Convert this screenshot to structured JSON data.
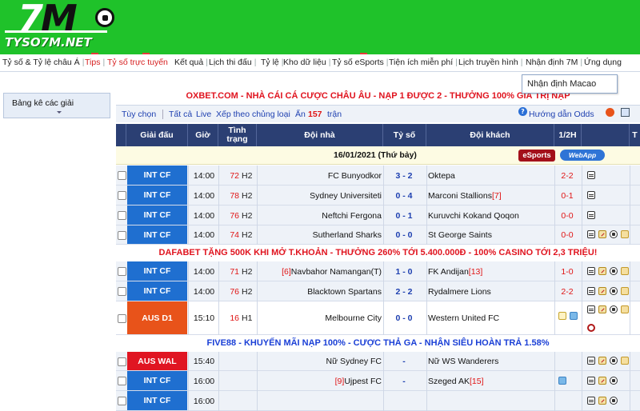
{
  "logo": {
    "seven": "7",
    "m": "M",
    "site": "TYSO7M.NET"
  },
  "nav": {
    "items": [
      "Tỷ số & Tỷ lệ châu Á",
      "Tips",
      "Tỷ số trực tuyến",
      "Kết quả",
      "Lịch thi đấu",
      "Tỷ lệ",
      "Kho dữ liệu",
      "Tỷ số eSports",
      "Tiện ích miễn phí",
      "Lịch truyền hình",
      "Nhận định 7M",
      "Ứng dụng"
    ],
    "dropdown": "Nhận định Macao"
  },
  "sidebar": {
    "label": "Bảng kê các giải"
  },
  "promos": {
    "top": "OXBET.COM - NHÀ CÁI CÁ CƯỢC CHÂU ÂU - NẠP 1 ĐƯỢC 2 - THƯỞNG 100% GIÁ TRỊ NẠP",
    "middle": "DAFABET TẶNG 500K KHI MỞ T.KHOẢN - THƯỞNG 260% TỚI 5.400.000Đ - 100% CASINO TỚI 2,3 TRIỆU!",
    "bottom": "FIVE88 - KHUYẾN MÃI NẠP 100% - CƯỢC THẢ GA - NHẬN SIÊU HOÀN TRẢ 1.58%"
  },
  "filter": {
    "custom": "Tùy chọn",
    "all": "Tất cả",
    "live": "Live",
    "sort": "Xếp theo chủng loại",
    "hide": "Ẩn",
    "hidden_count": "157",
    "matches": "trận",
    "guide": "Hướng dẫn Odds"
  },
  "columns": {
    "league": "Giải đấu",
    "time": "Giờ",
    "status": "Tình trạng",
    "home": "Đội nhà",
    "score": "Tỷ số",
    "away": "Đội khách",
    "half": "1/2H",
    "more": "T"
  },
  "date_row": {
    "date": "16/01/2021 (Thứ bảy)",
    "esports": "eSports",
    "webapp": "WebApp"
  },
  "matches": [
    {
      "league": "INT CF",
      "league_color": "#1f6fd0",
      "time": "14:00",
      "min": "72",
      "half": "H2",
      "home_rank": "",
      "home": "FC Bunyodkor",
      "score": "3 - 2",
      "away": "Oktepa",
      "away_rank": "",
      "ht": "2-2"
    },
    {
      "league": "INT CF",
      "league_color": "#1f6fd0",
      "time": "14:00",
      "min": "78",
      "half": "H2",
      "home_rank": "",
      "home": "Sydney Universiteti",
      "score": "0 - 4",
      "away": "Marconi Stallions",
      "away_rank": "[7]",
      "ht": "0-1"
    },
    {
      "league": "INT CF",
      "league_color": "#1f6fd0",
      "time": "14:00",
      "min": "76",
      "half": "H2",
      "home_rank": "",
      "home": "Neftchi Fergona",
      "score": "0 - 1",
      "away": "Kuruvchi Kokand Qoqon",
      "away_rank": "",
      "ht": "0-0"
    },
    {
      "league": "INT CF",
      "league_color": "#1f6fd0",
      "time": "14:00",
      "min": "74",
      "half": "H2",
      "home_rank": "",
      "home": "Sutherland Sharks",
      "score": "0 - 0",
      "away": "St George Saints",
      "away_rank": "",
      "ht": "0-0"
    },
    {
      "league": "INT CF",
      "league_color": "#1f6fd0",
      "time": "14:00",
      "min": "71",
      "half": "H2",
      "home_rank": "[6]",
      "home": "Navbahor Namangan(T)",
      "score": "1 - 0",
      "away": "FK Andijan",
      "away_rank": "[13]",
      "ht": "1-0"
    },
    {
      "league": "INT CF",
      "league_color": "#1f6fd0",
      "time": "14:00",
      "min": "76",
      "half": "H2",
      "home_rank": "",
      "home": "Blacktown Spartans",
      "score": "2 - 2",
      "away": "Rydalmere Lions",
      "away_rank": "",
      "ht": "2-2"
    },
    {
      "league": "AUS D1",
      "league_color": "#e8531a",
      "time": "15:10",
      "min": "16",
      "half": "H1",
      "home_rank": "",
      "home": "Melbourne City",
      "score": "0 - 0",
      "away": "Western United FC",
      "away_rank": "",
      "ht": ""
    },
    {
      "league": "AUS WAL",
      "league_color": "#e01522",
      "time": "15:40",
      "min": "",
      "half": "",
      "home_rank": "",
      "home": "Nữ Sydney FC",
      "score": "-",
      "away": "Nữ WS Wanderers",
      "away_rank": "",
      "ht": ""
    },
    {
      "league": "INT CF",
      "league_color": "#1f6fd0",
      "time": "16:00",
      "min": "",
      "half": "",
      "home_rank": "[9]",
      "home": "Ujpest FC",
      "score": "-",
      "away": "Szeged AK",
      "away_rank": "[15]",
      "ht": ""
    },
    {
      "league": "INT CF",
      "league_color": "#1f6fd0",
      "time": "16:00",
      "min": "",
      "half": "",
      "home_rank": "",
      "home": "",
      "score": "",
      "away": "",
      "away_rank": "",
      "ht": ""
    }
  ]
}
